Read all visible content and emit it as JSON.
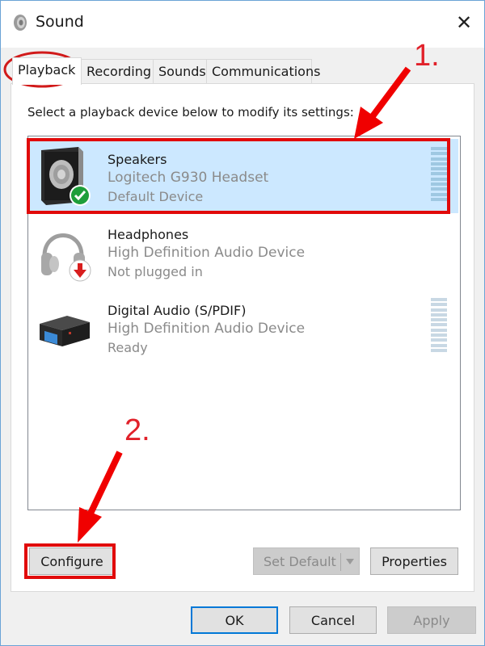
{
  "window": {
    "title": "Sound",
    "app_icon": "speaker-icon",
    "close_glyph": "✕"
  },
  "tabs": [
    {
      "label": "Playback",
      "active": true
    },
    {
      "label": "Recording",
      "active": false
    },
    {
      "label": "Sounds",
      "active": false
    },
    {
      "label": "Communications",
      "active": false
    }
  ],
  "panel": {
    "instruction": "Select a playback device below to modify its settings:"
  },
  "devices": [
    {
      "name": "Speakers",
      "description": "Logitech G930 Headset",
      "status": "Default Device",
      "icon": "speaker-icon",
      "badge": "green-check-icon",
      "selected": true,
      "level_meter": true
    },
    {
      "name": "Headphones",
      "description": "High Definition Audio Device",
      "status": "Not plugged in",
      "icon": "headphones-icon",
      "badge": "red-down-arrow-icon",
      "selected": false,
      "level_meter": false
    },
    {
      "name": "Digital Audio (S/PDIF)",
      "description": "High Definition Audio Device",
      "status": "Ready",
      "icon": "digital-audio-device-icon",
      "badge": null,
      "selected": false,
      "level_meter": true
    }
  ],
  "buttons": {
    "configure": "Configure",
    "set_default": "Set Default",
    "properties": "Properties",
    "ok": "OK",
    "cancel": "Cancel",
    "apply": "Apply"
  },
  "annotations": {
    "step1": "1.",
    "step2": "2.",
    "color": "#e10a0a"
  },
  "colors": {
    "selection": "#cce8ff",
    "accent": "#0078d7",
    "check_badge": "#1e9e3a",
    "unplugged_badge": "#d81e1e"
  }
}
